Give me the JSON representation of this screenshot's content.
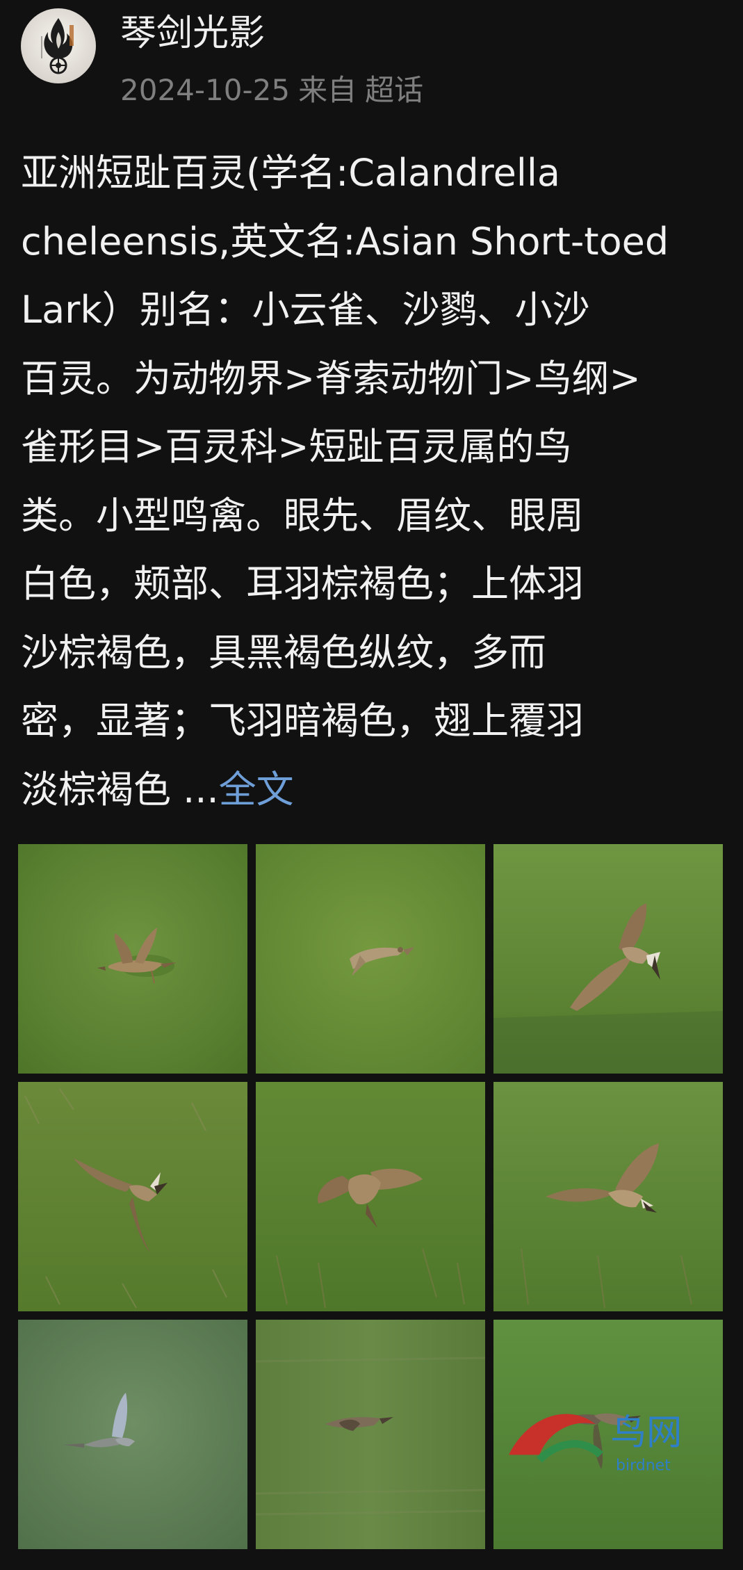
{
  "post": {
    "author": "琴剑光影",
    "date": "2024-10-25",
    "source_prefix": "来自",
    "source": "超话",
    "text_lines": [
      "亚洲短趾百灵(学名:Calandrella",
      "cheleensis,英文名:Asian Short-toed",
      "Lark）别名：小云雀、沙鹨、小沙",
      "百灵。为动物界>脊索动物门>鸟纲>",
      "雀形目>百灵科>短趾百灵属的鸟",
      "类。小型鸣禽。眼先、眉纹、眼周",
      "白色，颊部、耳羽棕褐色；上体羽",
      "沙棕褐色，具黑褐色纵纹，多而",
      "密，显著；飞羽暗褐色，翅上覆羽"
    ],
    "last_line_text": "淡棕褐色 ...",
    "read_more": "全文"
  },
  "gallery": {
    "photos": [
      "bird-photo-1",
      "bird-photo-2",
      "bird-photo-3",
      "bird-photo-4",
      "bird-photo-5",
      "bird-photo-6",
      "bird-photo-7",
      "bird-photo-8",
      "bird-photo-9"
    ]
  },
  "icons": {
    "avatar": "flame-logo-icon",
    "watermark": "site-watermark-icon"
  },
  "colors": {
    "background": "#111111",
    "text": "#f1f1f1",
    "meta": "#7f7f7f",
    "link": "#6f9fd8",
    "grass": "#5b7f35"
  }
}
